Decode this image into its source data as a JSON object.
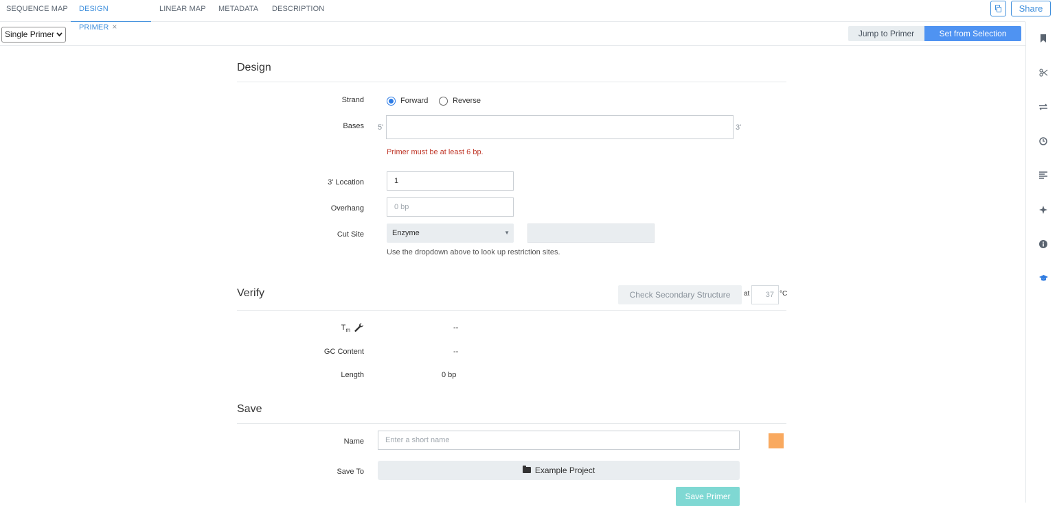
{
  "tabs": [
    {
      "label": "SEQUENCE MAP"
    },
    {
      "label": "DESIGN PRIMER",
      "active": true,
      "close": "×"
    },
    {
      "label": "LINEAR MAP"
    },
    {
      "label": "METADATA"
    },
    {
      "label": "DESCRIPTION"
    }
  ],
  "header": {
    "share_label": "Share",
    "copy_icon": "copy-icon"
  },
  "toolbar": {
    "mode_value": "Single Primer",
    "jump_label": "Jump to Primer",
    "set_selection_label": "Set from Selection"
  },
  "design": {
    "title": "Design",
    "strand_label": "Strand",
    "forward_label": "Forward",
    "reverse_label": "Reverse",
    "bases_label": "Bases",
    "five_prime": "5'",
    "three_prime": "3'",
    "bases_error": "Primer must be at least 6 bp.",
    "location_label": "3' Location",
    "location_value": "1",
    "overhang_label": "Overhang",
    "overhang_placeholder": "0 bp",
    "cutsite_label": "Cut Site",
    "enzyme_value": "Enzyme",
    "cutsite_hint": "Use the dropdown above to look up restriction sites."
  },
  "verify": {
    "title": "Verify",
    "check_label": "Check Secondary Structure",
    "at_label": "at",
    "temperature": "37",
    "unit": "°C",
    "tm_label_main": "T",
    "tm_label_sub": "m",
    "tm_value": "--",
    "gc_label": "GC Content",
    "gc_value": "--",
    "length_label": "Length",
    "length_value": "0 bp"
  },
  "save": {
    "title": "Save",
    "name_label": "Name",
    "name_placeholder": "Enter a short name",
    "saveto_label": "Save To",
    "project_name": "Example Project",
    "save_button": "Save Primer",
    "swatch_color": "#f9a95f"
  },
  "sidebar_icons": [
    "bookmark-icon",
    "scissors-icon",
    "transfer-icon",
    "history-icon",
    "align-icon",
    "feature-icon",
    "info-icon",
    "graduation-cap-icon"
  ]
}
